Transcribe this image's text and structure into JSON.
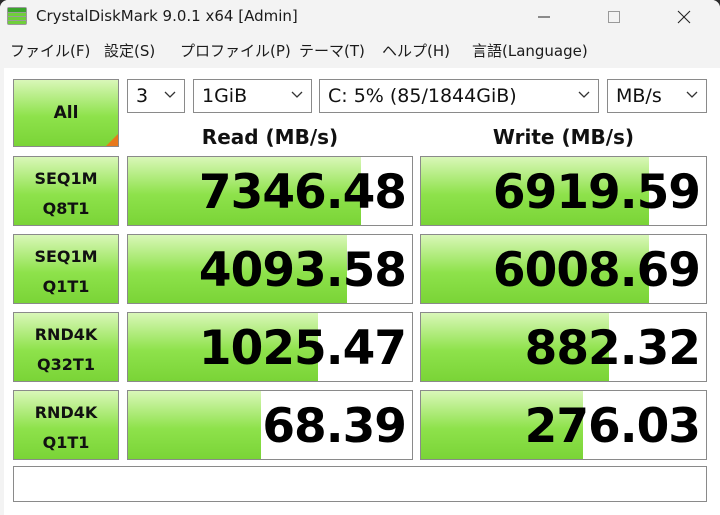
{
  "window": {
    "title": "CrystalDiskMark 9.0.1 x64 [Admin]"
  },
  "menu": [
    "ファイル(F)",
    "設定(S)",
    "プロファイル(P)",
    "テーマ(T)",
    "ヘルプ(H)",
    "言語(Language)"
  ],
  "controls": {
    "all_label": "All",
    "count": "3",
    "size": "1GiB",
    "drive": "C: 5% (85/1844GiB)",
    "unit": "MB/s"
  },
  "headers": {
    "read": "Read (MB/s)",
    "write": "Write (MB/s)"
  },
  "tests": [
    {
      "line1": "SEQ1M",
      "line2": "Q8T1",
      "read": "7346.48",
      "read_fill": 0.82,
      "write": "6919.59",
      "write_fill": 0.8
    },
    {
      "line1": "SEQ1M",
      "line2": "Q1T1",
      "read": "4093.58",
      "read_fill": 0.77,
      "write": "6008.69",
      "write_fill": 0.8
    },
    {
      "line1": "RND4K",
      "line2": "Q32T1",
      "read": "1025.47",
      "read_fill": 0.67,
      "write": "882.32",
      "write_fill": 0.66
    },
    {
      "line1": "RND4K",
      "line2": "Q1T1",
      "read": "68.39",
      "read_fill": 0.47,
      "write": "276.03",
      "write_fill": 0.57
    }
  ],
  "comment": "",
  "colors": {
    "bar_green": "#8ee24b",
    "corner_orange": "#e8791d"
  }
}
